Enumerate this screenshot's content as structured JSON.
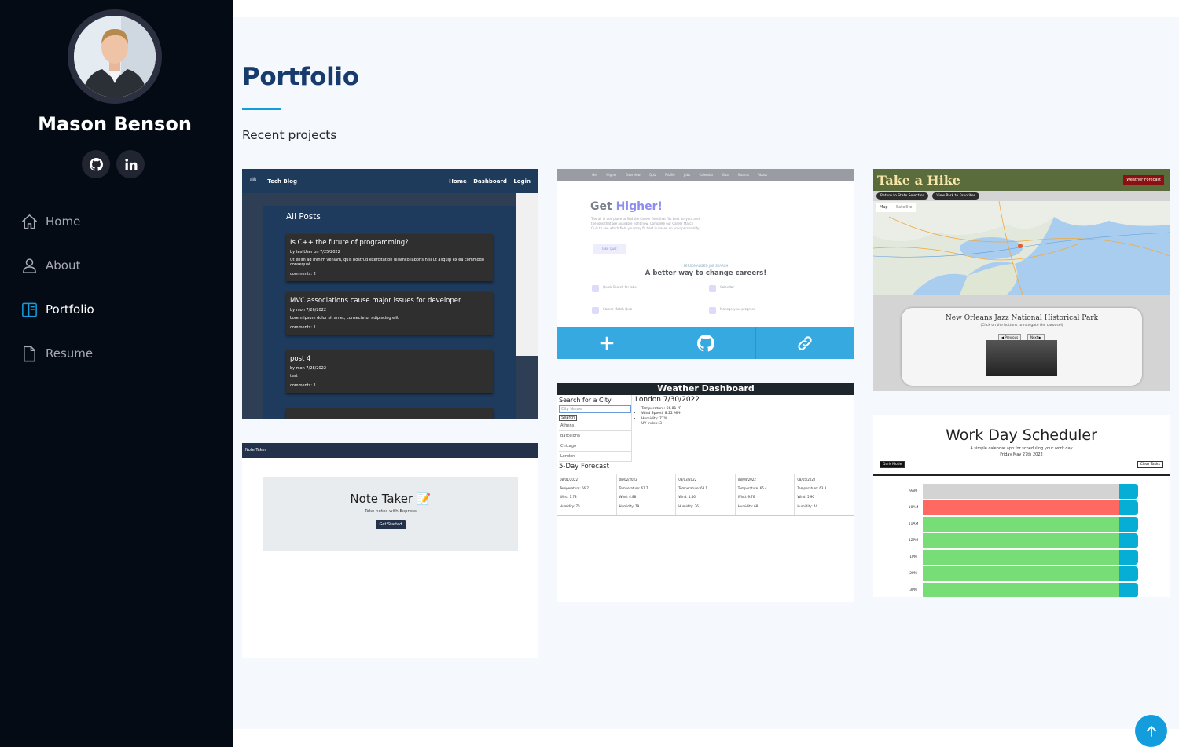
{
  "profile": {
    "name": "Mason Benson",
    "social": [
      {
        "name": "github",
        "icon": "github-icon"
      },
      {
        "name": "linkedin",
        "icon": "linkedin-icon",
        "label": "in"
      }
    ]
  },
  "nav": [
    {
      "label": "Home",
      "icon": "home-icon",
      "active": false
    },
    {
      "label": "About",
      "icon": "person-icon",
      "active": false
    },
    {
      "label": "Portfolio",
      "icon": "book-icon",
      "active": true
    },
    {
      "label": "Resume",
      "icon": "file-icon",
      "active": false
    }
  ],
  "portfolio": {
    "title": "Portfolio",
    "subtitle": "Recent projects"
  },
  "projects": {
    "tech_blog": {
      "brand": "Tech Blog",
      "nav_links": "Home Dashboard Login",
      "heading": "All Posts",
      "posts": [
        {
          "title": "Is C++ the future of programming?",
          "meta": "by testUser on 7/25/2022",
          "body": "Ut enim ad minim veniam, quis nostrud exercitation ullamco laboris nisi ut aliquip ex ea commodo consequat.",
          "comments": "comments: 2"
        },
        {
          "title": "MVC associations cause major issues for developer",
          "meta": "by mon 7/26/2022",
          "body": "Lorem ipsum dolor sit amet, consectetur adipiscing elit",
          "comments": "comments: 1"
        },
        {
          "title": "post 4",
          "meta": "by mon 7/28/2022",
          "body": "test",
          "comments": "comments: 1"
        }
      ]
    },
    "get_higher": {
      "nav": "Get Higher  Overview  Quiz  Profile  Jobs  Calendar  Goal Boards  About",
      "title_a": "Get ",
      "title_b": "Higher!",
      "desc": "The all in one place to find the Career field that fits best for you, and the jobs that are available right now. Complete our Career Match Quiz to see which field you may fit best in based on your personality!",
      "button": "Take Quiz",
      "eyebrow": "PERSONALIZED JOB SEARCH",
      "headline": "A better way to change careers!",
      "features": [
        "Quick Search for Jobs",
        "Calendar",
        "Career Match Quiz",
        "Manage your progress"
      ]
    },
    "take_a_hike": {
      "title": "Take a Hike",
      "forecast_button": "Weather Forecast",
      "sub_buttons": [
        "Return to State Selection",
        "View Park to Favorites"
      ],
      "map_tabs": [
        "Map",
        "Satellite"
      ],
      "park": "New Orleans Jazz National Historical Park",
      "hint": "(Click on the buttons to navigate the carousel)",
      "prev": "◀ Previous",
      "next": "Next ▶"
    },
    "weather": {
      "header": "Weather Dashboard",
      "search_label": "Search for a City:",
      "placeholder": "City Name",
      "search_button": "Search",
      "cities": [
        "Athens",
        "Barcelona",
        "Chicago",
        "London"
      ],
      "current": "London 7/30/2022",
      "conditions": [
        "Temperature: 66.81 °F",
        "Wind Speed: 8.22 MPH",
        "Humidity: 77%",
        "UV Index: 3"
      ],
      "forecast_title": "5-Day Forecast",
      "forecast": [
        {
          "date": "08/01/2022",
          "temp": "Temperature: 66.7",
          "wind": "Wind: 1.78",
          "hum": "Humidity: 70"
        },
        {
          "date": "08/02/2022",
          "temp": "Temperature: 67.7",
          "wind": "Wind: 4.88",
          "hum": "Humidity: 79"
        },
        {
          "date": "08/03/2022",
          "temp": "Temperature: 68.1",
          "wind": "Wind: 1.46",
          "hum": "Humidity: 76"
        },
        {
          "date": "08/04/2022",
          "temp": "Temperature: 66.4",
          "wind": "Wind: 9.76",
          "hum": "Humidity: 68"
        },
        {
          "date": "08/05/2022",
          "temp": "Temperature: 63.8",
          "wind": "Wind: 5.90",
          "hum": "Humidity: 44"
        }
      ]
    },
    "note_taker": {
      "nav": "Note Taker",
      "title": "Note Taker 📝",
      "tagline": "Take notes with Express",
      "button": "Get Started"
    },
    "scheduler": {
      "title": "Work Day Scheduler",
      "sub": "A simple calendar app for scheduling your work day",
      "date": "Friday May 27th 2022",
      "dark_mode": "Dark Mode",
      "clear": "Clear Tasks",
      "hours": [
        "9AM",
        "10AM",
        "11AM",
        "12PM",
        "1PM",
        "2PM",
        "3PM"
      ],
      "colors": [
        "#d3d3d3",
        "#ff6961",
        "#77dd77",
        "#77dd77",
        "#77dd77",
        "#77dd77",
        "#77dd77"
      ]
    }
  },
  "colors": {
    "sidebar_bg": "#040b14",
    "accent": "#149ddd",
    "title": "#173b6c",
    "main_bg": "#f5f8fd"
  }
}
